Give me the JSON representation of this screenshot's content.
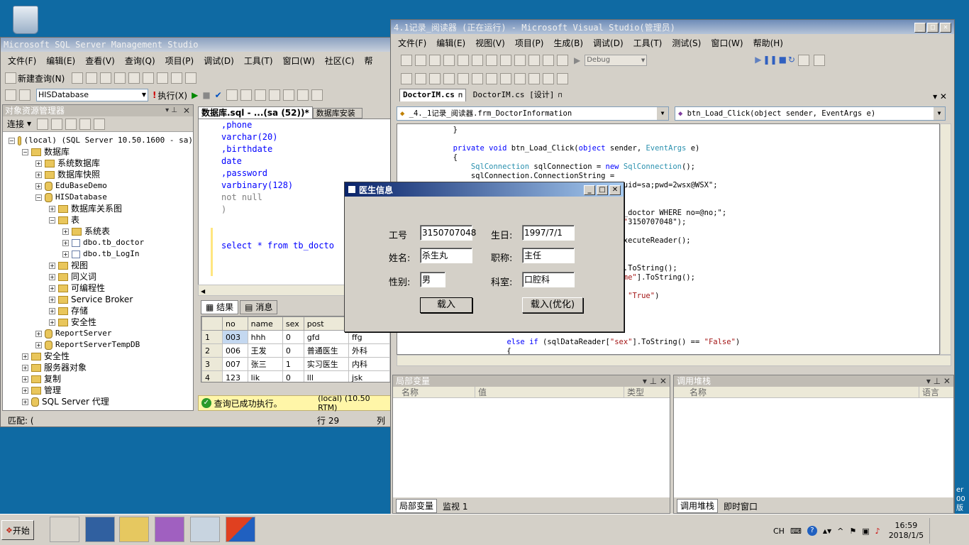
{
  "desktop": {
    "edge_text_1": "er",
    "edge_text_2": "00",
    "edge_text_3": "版"
  },
  "ssms": {
    "title": "Microsoft SQL Server Management Studio",
    "menu": [
      "文件(F)",
      "编辑(E)",
      "查看(V)",
      "查询(Q)",
      "项目(P)",
      "调试(D)",
      "工具(T)",
      "窗口(W)",
      "社区(C)",
      "帮"
    ],
    "toolbar": {
      "new_query": "新建查询(N)",
      "database": "HISDatabase",
      "execute": "执行(X)"
    },
    "explorer": {
      "title": "对象资源管理器",
      "connect": "连接",
      "nodes": [
        {
          "label": "(local) (SQL Server 10.50.1600 - sa)",
          "indent": 0,
          "exp": "−",
          "icon": "server"
        },
        {
          "label": "数据库",
          "indent": 1,
          "exp": "−",
          "icon": "folder"
        },
        {
          "label": "系统数据库",
          "indent": 2,
          "exp": "+",
          "icon": "folder"
        },
        {
          "label": "数据库快照",
          "indent": 2,
          "exp": "+",
          "icon": "folder"
        },
        {
          "label": "EduBaseDemo",
          "indent": 2,
          "exp": "+",
          "icon": "db"
        },
        {
          "label": "HISDatabase",
          "indent": 2,
          "exp": "−",
          "icon": "db"
        },
        {
          "label": "数据库关系图",
          "indent": 3,
          "exp": "+",
          "icon": "folder"
        },
        {
          "label": "表",
          "indent": 3,
          "exp": "−",
          "icon": "folder"
        },
        {
          "label": "系统表",
          "indent": 4,
          "exp": "+",
          "icon": "folder"
        },
        {
          "label": "dbo.tb_doctor",
          "indent": 4,
          "exp": "+",
          "icon": "table"
        },
        {
          "label": "dbo.tb_LogIn",
          "indent": 4,
          "exp": "+",
          "icon": "table"
        },
        {
          "label": "视图",
          "indent": 3,
          "exp": "+",
          "icon": "folder"
        },
        {
          "label": "同义词",
          "indent": 3,
          "exp": "+",
          "icon": "folder"
        },
        {
          "label": "可编程性",
          "indent": 3,
          "exp": "+",
          "icon": "folder"
        },
        {
          "label": "Service Broker",
          "indent": 3,
          "exp": "+",
          "icon": "folder"
        },
        {
          "label": "存储",
          "indent": 3,
          "exp": "+",
          "icon": "folder"
        },
        {
          "label": "安全性",
          "indent": 3,
          "exp": "+",
          "icon": "folder"
        },
        {
          "label": "ReportServer",
          "indent": 2,
          "exp": "+",
          "icon": "db"
        },
        {
          "label": "ReportServerTempDB",
          "indent": 2,
          "exp": "+",
          "icon": "db"
        },
        {
          "label": "安全性",
          "indent": 1,
          "exp": "+",
          "icon": "folder"
        },
        {
          "label": "服务器对象",
          "indent": 1,
          "exp": "+",
          "icon": "folder"
        },
        {
          "label": "复制",
          "indent": 1,
          "exp": "+",
          "icon": "folder"
        },
        {
          "label": "管理",
          "indent": 1,
          "exp": "+",
          "icon": "folder"
        },
        {
          "label": "SQL Server 代理",
          "indent": 1,
          "exp": "+",
          "icon": "agent"
        }
      ]
    },
    "editor": {
      "tab1": "数据库.sql - ...(sa (52))*",
      "tab2": "数据库安装",
      "lines": [
        ",phone",
        "varchar(20)",
        ",birthdate",
        "date",
        ",password",
        "varbinary(128)",
        "not null",
        ")",
        "",
        "",
        "select * from tb_docto"
      ]
    },
    "results": {
      "tab_results": "结果",
      "tab_messages": "消息",
      "columns": [
        "no",
        "name",
        "sex",
        "post",
        ""
      ],
      "rows": [
        {
          "n": "1",
          "cells": [
            "003",
            "hhh",
            "0",
            "gfd",
            "ffg"
          ]
        },
        {
          "n": "2",
          "cells": [
            "006",
            "王发",
            "0",
            "普通医生",
            "外科"
          ]
        },
        {
          "n": "3",
          "cells": [
            "007",
            "张三",
            "1",
            "实习医生",
            "内科"
          ]
        },
        {
          "n": "4",
          "cells": [
            "123",
            "lik",
            "0",
            "lll",
            "jsk"
          ]
        }
      ]
    },
    "status": {
      "msg": "查询已成功执行。",
      "server": "(local) (10.50 RTM)"
    },
    "bottom": {
      "match": "匹配: (",
      "row": "行 29",
      "col": "列"
    }
  },
  "vs": {
    "title": "4.1记录_阅读器 (正在运行) - Microsoft Visual Studio(管理员)",
    "menu": [
      "文件(F)",
      "编辑(E)",
      "视图(V)",
      "项目(P)",
      "生成(B)",
      "调试(D)",
      "工具(T)",
      "测试(S)",
      "窗口(W)",
      "帮助(H)"
    ],
    "config": "Debug",
    "tabs": [
      "DoctorIM.cs",
      "DoctorIM.cs [设计]"
    ],
    "class_dropdown": "_4._1记录_阅读器.frm_DoctorInformation",
    "member_dropdown": "btn_Load_Click(object sender, EventArgs e)",
    "code": [
      "        }",
      "",
      "        private void btn_Load_Click(object sender, EventArgs e)",
      "        {",
      "            SqlConnection sqlConnection = new SqlConnection();",
      "            sqlConnection.ConnectionString =",
      "                                          ase;uid=sa;pwd=2wsx@WSX\";",
      "                                          );",
      "",
      "                                          M tb_doctor WHERE no=@no;\";",
      "                                          o\", \"3150707048\");",
      "",
      "                                          nd.ExecuteReader();",
      "",
      "",
      "                                          no\"].ToString();",
      "                                          [\"name\"].ToString();",
      "",
      "                                          ()== \"True\")",
      "",
      "",
      "",
      "",
      "                    else if (sqlDataReader[\"sex\"].ToString() == \"False\")",
      "                    {"
    ],
    "locals": {
      "title": "局部变量",
      "cols": [
        "名称",
        "值",
        "类型"
      ]
    },
    "callstack": {
      "title": "调用堆栈",
      "cols": [
        "名称",
        "语言"
      ]
    },
    "bottom_tabs_left": [
      "局部变量",
      "监视 1"
    ],
    "bottom_tabs_right": [
      "调用堆栈",
      "即时窗口"
    ]
  },
  "dialog": {
    "title": "医生信息",
    "fields": {
      "id_label": "工号",
      "id_value": "3150707048",
      "birth_label": "生日:",
      "birth_value": "1997/7/1",
      "name_label": "姓名:",
      "name_value": "杀生丸",
      "title_label": "职称:",
      "title_value": "主任",
      "sex_label": "性别:",
      "sex_value": "男",
      "dept_label": "科室:",
      "dept_value": "口腔科"
    },
    "btn_load": "载入",
    "btn_load_opt": "载入(优化)"
  },
  "taskbar": {
    "start": "开始",
    "lang": "CH",
    "time": "16:59",
    "date": "2018/1/5"
  }
}
